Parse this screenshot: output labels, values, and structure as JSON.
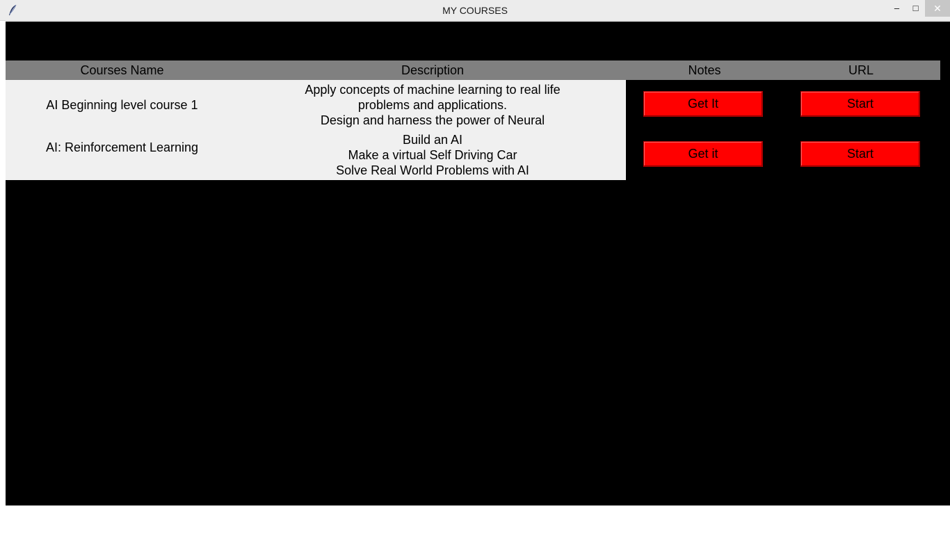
{
  "window": {
    "title": "MY COURSES",
    "minimize_glyph": "–",
    "maximize_glyph": "□",
    "close_glyph": "✕",
    "app_icon": "feather-icon"
  },
  "table": {
    "headers": {
      "name": "Courses Name",
      "description": "Description",
      "notes": "Notes",
      "url": "URL"
    },
    "rows": [
      {
        "name": "AI Beginning level course 1",
        "description": [
          "Apply concepts of machine learning to real life",
          "problems and applications.",
          "Design and harness the power of Neural"
        ],
        "notes_button": "Get It",
        "url_button": "Start"
      },
      {
        "name": "AI: Reinforcement Learning",
        "description": [
          "Build an AI",
          "Make a virtual Self Driving Car",
          "Solve Real World Problems with AI"
        ],
        "notes_button": "Get it",
        "url_button": "Start"
      }
    ]
  },
  "colors": {
    "background": "#000000",
    "header_bg": "#808080",
    "panel_bg": "#f0f0f0",
    "button_bg": "#ff0000"
  }
}
